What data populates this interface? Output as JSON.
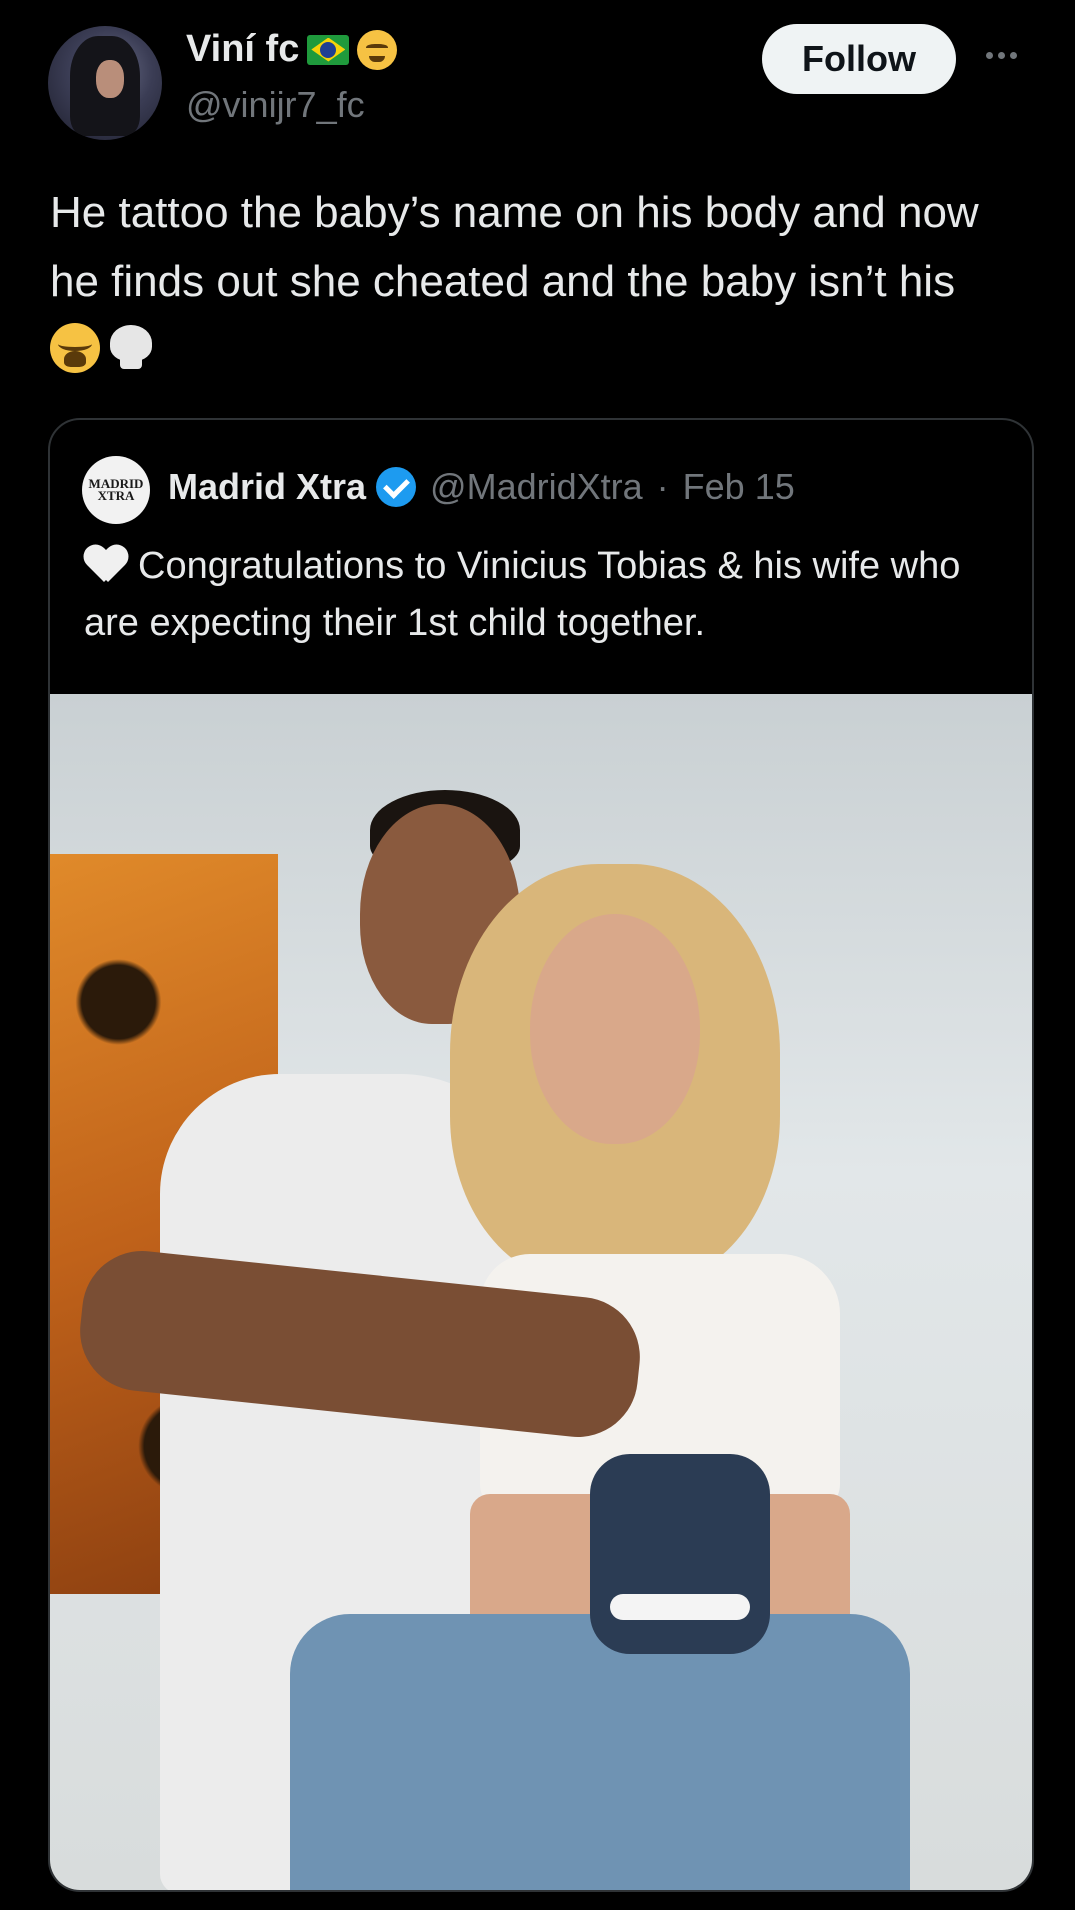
{
  "tweet": {
    "display_name": "Viní fc",
    "name_icons": [
      "brazil-flag-icon",
      "angry-face-icon"
    ],
    "handle": "@vinijr7_fc",
    "follow_label": "Follow",
    "text": "He tattoo the baby’s name on his body and now he finds out she cheated and the baby isn’t his",
    "text_emojis": [
      "loudly-crying-face-icon",
      "skull-icon"
    ]
  },
  "quote": {
    "avatar_line1": "MADRID",
    "avatar_line2": "XTRA",
    "name": "Madrid Xtra",
    "handle": "@MadridXtra",
    "separator": "·",
    "date": "Feb 15",
    "text": "Congratulations to Vinicius Tobias & his wife who are expecting their 1st child together."
  },
  "colors": {
    "background": "#000000",
    "text_primary": "#e7e9ea",
    "text_secondary": "#71767b",
    "verified": "#1d9bf0",
    "border": "#2f3336"
  }
}
